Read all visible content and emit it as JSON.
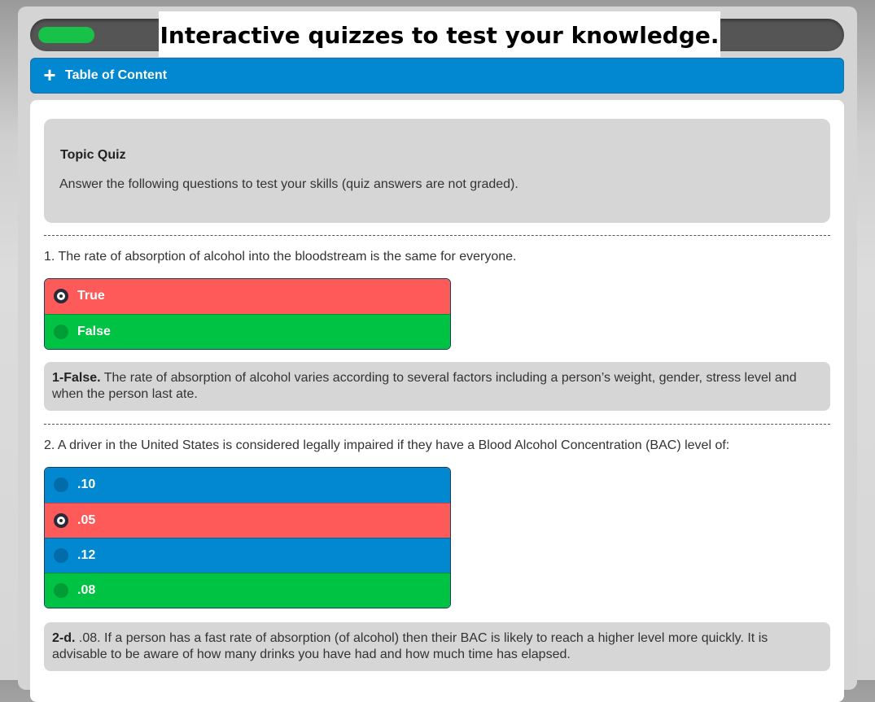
{
  "header": {
    "title": "Interactive quizzes to test your knowledge.",
    "progress": 0.07,
    "progress_color": "#18c147"
  },
  "toc": {
    "icon": "plus-icon",
    "label": "Table of Content"
  },
  "intro": {
    "title": "Topic Quiz",
    "text": "Answer the following questions to test your skills (quiz answers are not graded)."
  },
  "questions": [
    {
      "text": "1. The rate of absorption of alcohol into the bloodstream is the same for everyone.",
      "options": [
        {
          "label": "True",
          "state": "selected-wrong",
          "color": "#ff5a5a"
        },
        {
          "label": "False",
          "state": "correct",
          "color": "#00c343"
        }
      ],
      "answer_key": "1-False.",
      "answer_text": " The rate of absorption of alcohol varies according to several factors including a person’s weight, gender, stress level and when the person last ate."
    },
    {
      "text": "2. A driver in the United States is considered legally impaired if they have a Blood Alcohol Concentration (BAC) level of:",
      "options": [
        {
          "label": ".10",
          "state": "unselected",
          "color": "#0288d1"
        },
        {
          "label": ".05",
          "state": "selected-wrong",
          "color": "#ff5a5a"
        },
        {
          "label": ".12",
          "state": "unselected",
          "color": "#0288d1"
        },
        {
          "label": ".08",
          "state": "correct",
          "color": "#00c343"
        }
      ],
      "answer_key": "2-d.",
      "answer_text": " .08. If a person has a fast rate of absorption (of alcohol) then their BAC is likely to reach a higher level more quickly. It is advisable to be aware of how many drinks you have had and how much time has elapsed."
    }
  ]
}
